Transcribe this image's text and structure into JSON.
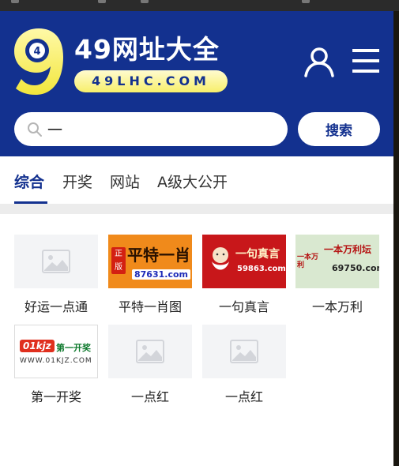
{
  "header": {
    "title": "49网址大全",
    "domain": "49LHC.COM",
    "logo_digits": "9",
    "logo_ball": "4"
  },
  "search": {
    "value": "一",
    "placeholder": "",
    "button_label": "搜索"
  },
  "tabs": [
    {
      "label": "综合",
      "active": true
    },
    {
      "label": "开奖",
      "active": false
    },
    {
      "label": "网站",
      "active": false
    },
    {
      "label": "A级大公开",
      "active": false
    }
  ],
  "cards": [
    {
      "label": "好运一点通",
      "thumb": "placeholder"
    },
    {
      "label": "平特一肖图",
      "thumb": "ad",
      "ad_badge": "正版",
      "ad_text": "平特一肖",
      "ad_url": "87631.com"
    },
    {
      "label": "一句真言",
      "thumb": "ad",
      "ad_text": "一句真言",
      "ad_url": "59863.com"
    },
    {
      "label": "一本万利",
      "thumb": "ad",
      "ad_mark": "一本万利",
      "ad_text": "一本万利坛",
      "ad_url": "69750.com"
    },
    {
      "label": "第一开奖",
      "thumb": "ad",
      "ad_brand": "01kjz",
      "ad_text": "第一开奖",
      "ad_url": "WWW.01KJZ.COM"
    },
    {
      "label": "一点红",
      "thumb": "placeholder"
    },
    {
      "label": "一点红",
      "thumb": "placeholder"
    }
  ],
  "colors": {
    "brand_blue": "#13318f",
    "pill_yellow": "#f7ef6a",
    "divider": "#ececec"
  },
  "icons": {
    "user": "user-icon",
    "menu": "hamburger-menu-icon",
    "search": "magnifier-icon",
    "placeholder": "image-placeholder-icon"
  }
}
